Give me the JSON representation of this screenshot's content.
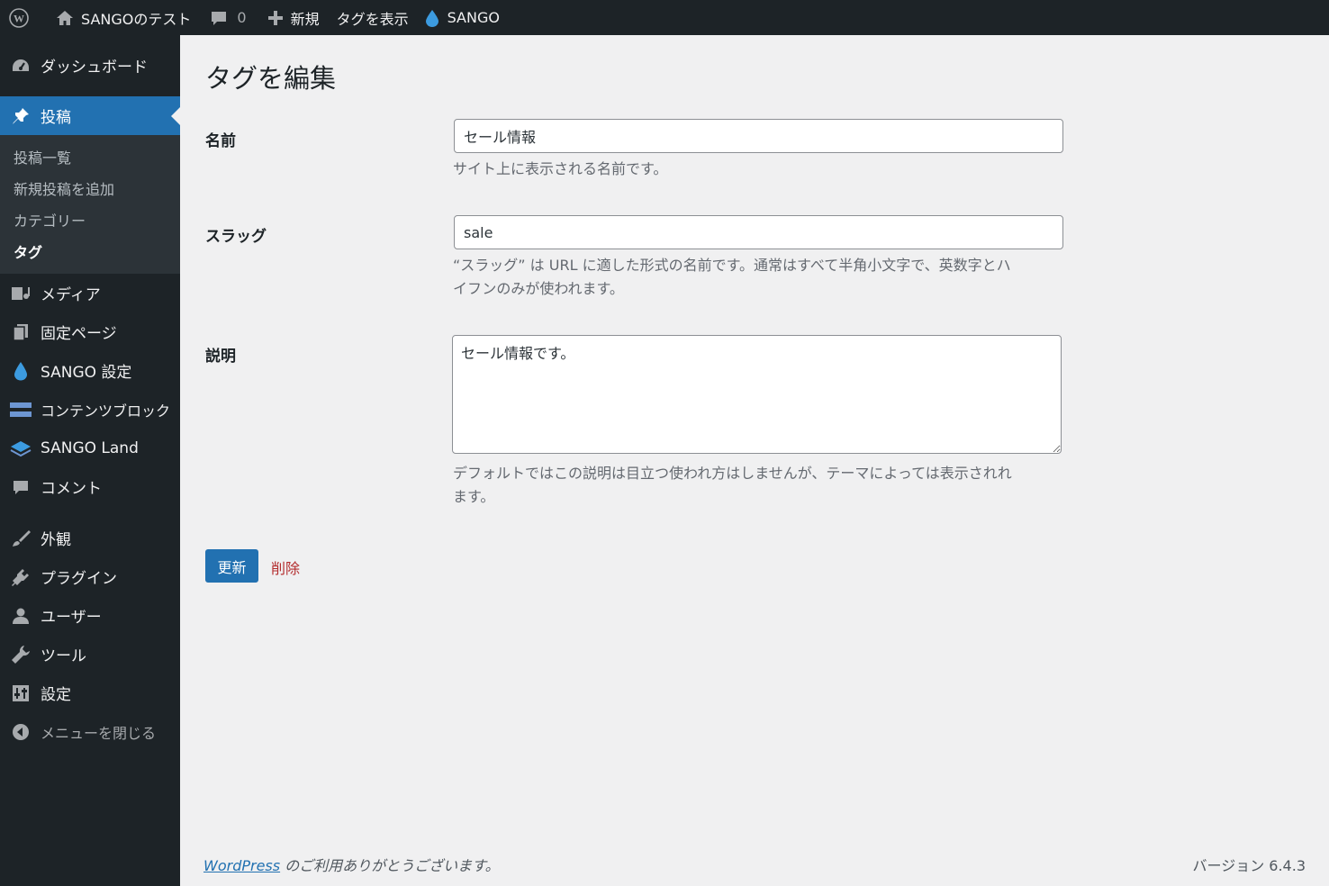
{
  "admin_bar": {
    "site_name": "SANGOのテスト",
    "comment_count": "0",
    "new_label": "新規",
    "view_tag_label": "タグを表示",
    "sango_label": "SANGO"
  },
  "sidebar": {
    "dashboard": "ダッシュボード",
    "posts": "投稿",
    "submenu": {
      "all_posts": "投稿一覧",
      "add_new": "新規投稿を追加",
      "categories": "カテゴリー",
      "tags": "タグ"
    },
    "media": "メディア",
    "pages": "固定ページ",
    "sango_settings": "SANGO 設定",
    "content_blocks": "コンテンツブロック",
    "sango_land": "SANGO Land",
    "comments": "コメント",
    "appearance": "外観",
    "plugins": "プラグイン",
    "users": "ユーザー",
    "tools": "ツール",
    "settings": "設定",
    "collapse": "メニューを閉じる"
  },
  "page": {
    "title": "タグを編集",
    "name_label": "名前",
    "name_value": "セール情報",
    "name_hint": "サイト上に表示される名前です。",
    "slug_label": "スラッグ",
    "slug_value": "sale",
    "slug_hint_line1": "“スラッグ” は URL に適した形式の名前です。通常はすべて半角小文字で、英数字とハ",
    "slug_hint_line2": "イフンのみが使われます。",
    "desc_label": "説明",
    "desc_value": "セール情報です。",
    "desc_hint_line1": "デフォルトではこの説明は目立つ使われ方はしませんが、テーマによっては表示されれ",
    "desc_hint_line2": "ます。",
    "update_button": "更新",
    "delete_link": "削除"
  },
  "footer": {
    "wordpress_link": "WordPress",
    "thanks_text": " のご利用ありがとうございます。",
    "version": "バージョン 6.4.3"
  },
  "colors": {
    "admin_dark": "#1d2327",
    "accent_blue": "#2271b1",
    "delete_red": "#b32d2e",
    "page_bg": "#f0f0f1"
  }
}
